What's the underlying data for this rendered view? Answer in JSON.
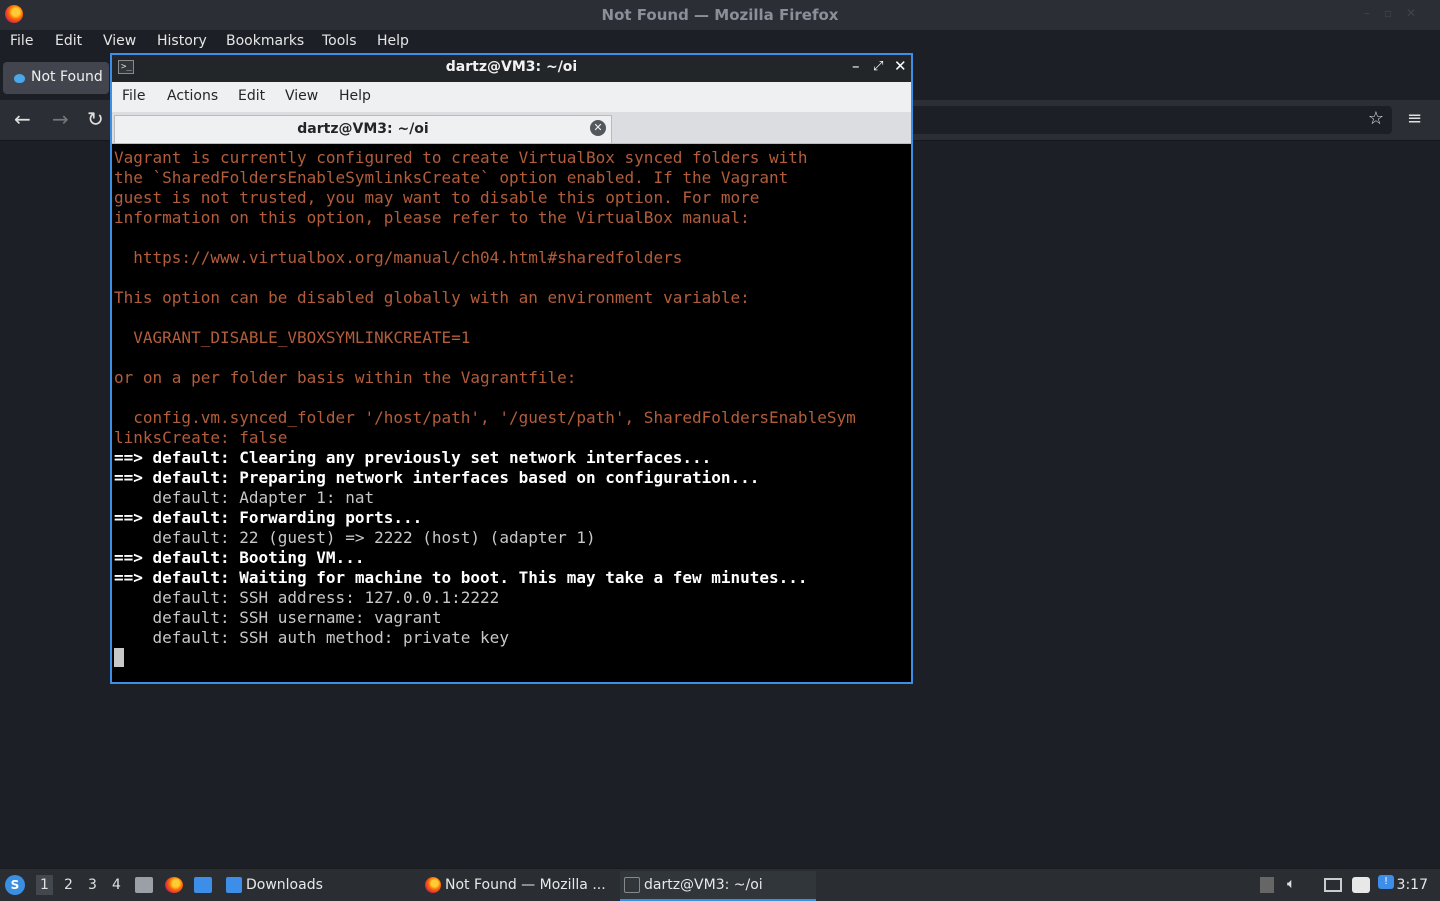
{
  "firefox": {
    "window_title": "Not Found — Mozilla Firefox",
    "menu": [
      "File",
      "Edit",
      "View",
      "History",
      "Bookmarks",
      "Tools",
      "Help"
    ],
    "tab_label": "Not Found"
  },
  "terminal": {
    "window_title": "dartz@VM3: ~/oi",
    "menu": [
      "File",
      "Actions",
      "Edit",
      "View",
      "Help"
    ],
    "tab_label": "dartz@VM3: ~/oi",
    "lines": [
      {
        "text": "Vagrant is currently configured to create VirtualBox synced folders with",
        "style": "warn"
      },
      {
        "text": "the `SharedFoldersEnableSymlinksCreate` option enabled. If the Vagrant",
        "style": "warn"
      },
      {
        "text": "guest is not trusted, you may want to disable this option. For more",
        "style": "warn"
      },
      {
        "text": "information on this option, please refer to the VirtualBox manual:",
        "style": "warn"
      },
      {
        "text": "",
        "style": "warn"
      },
      {
        "text": "  https://www.virtualbox.org/manual/ch04.html#sharedfolders",
        "style": "warn"
      },
      {
        "text": "",
        "style": "warn"
      },
      {
        "text": "This option can be disabled globally with an environment variable:",
        "style": "warn"
      },
      {
        "text": "",
        "style": "warn"
      },
      {
        "text": "  VAGRANT_DISABLE_VBOXSYMLINKCREATE=1",
        "style": "warn"
      },
      {
        "text": "",
        "style": "warn"
      },
      {
        "text": "or on a per folder basis within the Vagrantfile:",
        "style": "warn"
      },
      {
        "text": "",
        "style": "warn"
      },
      {
        "text": "  config.vm.synced_folder '/host/path', '/guest/path', SharedFoldersEnableSym",
        "style": "warn"
      },
      {
        "text": "linksCreate: false",
        "style": "warn"
      },
      {
        "text": "==> default: Clearing any previously set network interfaces...",
        "style": "info"
      },
      {
        "text": "==> default: Preparing network interfaces based on configuration...",
        "style": "info"
      },
      {
        "text": "    default: Adapter 1: nat",
        "style": "detail"
      },
      {
        "text": "==> default: Forwarding ports...",
        "style": "info"
      },
      {
        "text": "    default: 22 (guest) => 2222 (host) (adapter 1)",
        "style": "detail"
      },
      {
        "text": "==> default: Booting VM...",
        "style": "info"
      },
      {
        "text": "==> default: Waiting for machine to boot. This may take a few minutes...",
        "style": "info"
      },
      {
        "text": "    default: SSH address: 127.0.0.1:2222",
        "style": "detail"
      },
      {
        "text": "    default: SSH username: vagrant",
        "style": "detail"
      },
      {
        "text": "    default: SSH auth method: private key",
        "style": "detail"
      }
    ]
  },
  "taskbar": {
    "workspaces": [
      "1",
      "2",
      "3",
      "4"
    ],
    "tasks": [
      "Downloads",
      "Not Found — Mozilla ...",
      "dartz@VM3: ~/oi"
    ],
    "clock": "3:17",
    "colors": {
      "accent": "#3d8ee8",
      "terminal_warning": "#b35d3b"
    }
  }
}
